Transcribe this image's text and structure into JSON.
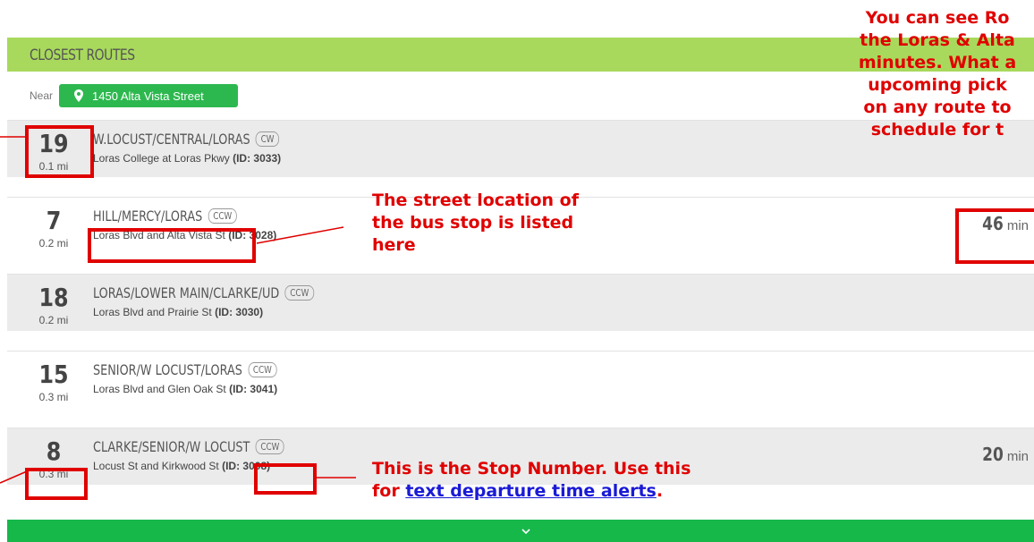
{
  "panel": {
    "title": "CLOSEST ROUTES",
    "near_label": "Near",
    "location": "1450 Alta Vista Street",
    "location_icon": "map-pin-icon",
    "expand_icon": "chevron-down-icon"
  },
  "routes": [
    {
      "number": "19",
      "distance": "0.1 mi",
      "name": "W.LOCUST/CENTRAL/LORAS",
      "direction": "CW",
      "stop": "Loras College at Loras Pkwy",
      "stop_id": "(ID: 3033)",
      "eta": "",
      "eta_unit": ""
    },
    {
      "number": "7",
      "distance": "0.2 mi",
      "name": "HILL/MERCY/LORAS",
      "direction": "CCW",
      "stop": "Loras Blvd and Alta Vista St",
      "stop_id": "(ID: 3028)",
      "eta": "46",
      "eta_unit": "min"
    },
    {
      "number": "18",
      "distance": "0.2 mi",
      "name": "LORAS/LOWER MAIN/CLARKE/UD",
      "direction": "CCW",
      "stop": "Loras Blvd and Prairie St",
      "stop_id": "(ID: 3030)",
      "eta": "",
      "eta_unit": ""
    },
    {
      "number": "15",
      "distance": "0.3 mi",
      "name": "SENIOR/W LOCUST/LORAS",
      "direction": "CCW",
      "stop": "Loras Blvd and Glen Oak St",
      "stop_id": "(ID: 3041)",
      "eta": "",
      "eta_unit": ""
    },
    {
      "number": "8",
      "distance": "0.3 mi",
      "name": "CLARKE/SENIOR/W LOCUST",
      "direction": "CCW",
      "stop": "Locust St and Kirkwood St",
      "stop_id": "(ID: 3008)",
      "eta": "20",
      "eta_unit": "min"
    }
  ],
  "annotations": {
    "top_right": [
      "You can see Ro",
      "the Loras & Alta",
      "minutes. What a",
      "upcoming pick",
      "on any route to",
      "schedule for t"
    ],
    "street_location": [
      "The street location of",
      "the bus stop is listed",
      "here"
    ],
    "stop_number_line1": "This is the Stop Number. Use this",
    "stop_number_prefix": "for ",
    "stop_number_link": "text departure time alerts",
    "stop_number_suffix": ".",
    "color": "#e00000",
    "link_color": "#1a1ad6"
  },
  "colors": {
    "header": "#a8d95c",
    "location_button": "#2db84f",
    "expand_bar": "#16b84a",
    "row_grey": "#ebebeb"
  }
}
